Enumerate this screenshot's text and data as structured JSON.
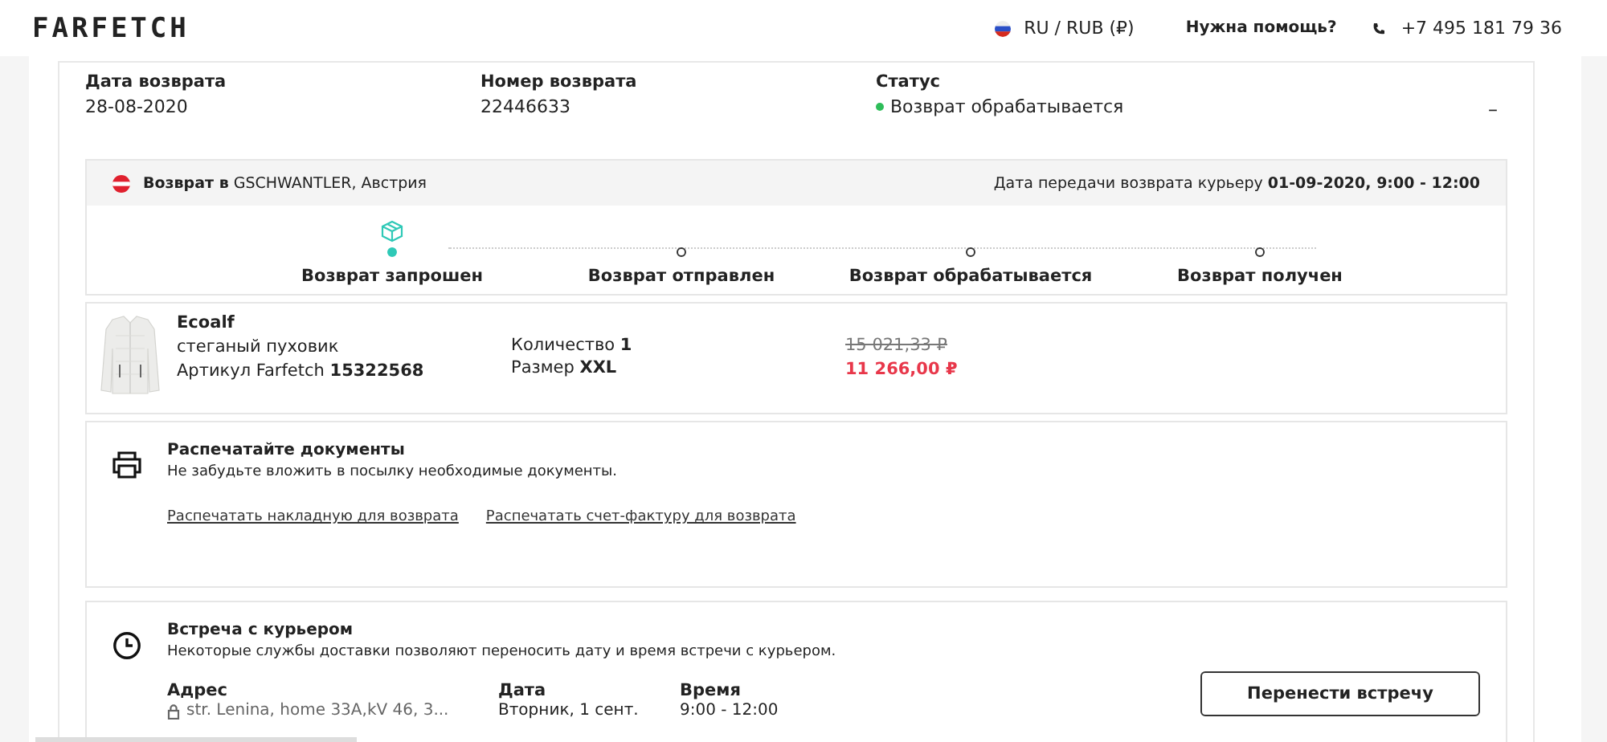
{
  "header": {
    "logo": "FARFETCH",
    "currency": "RU / RUB (₽)",
    "help": "Нужна помощь?",
    "phone": "+7 495 181 79 36"
  },
  "summary": {
    "fields": [
      {
        "label": "Дата возврата",
        "value": "28-08-2020"
      },
      {
        "label": "Номер возврата",
        "value": "22446633"
      },
      {
        "label": "Статус",
        "value": "Возврат обрабатывается",
        "color": "#2ebd59"
      }
    ],
    "collapse": "–"
  },
  "shipment": {
    "to": "**Возврат в** GSCHWANTLER, Австрия",
    "handover": "Дата передачи возврата курьеру **01-09-2020, 9:00 - 12:00**",
    "steps": [
      {
        "label": "Возврат запрошен",
        "selected": true
      },
      {
        "label": "Возврат отправлен",
        "selected": false
      },
      {
        "label": "Возврат обрабатывается",
        "selected": false
      },
      {
        "label": "Возврат получен",
        "selected": false
      }
    ]
  },
  "item": {
    "brand": "Ecoalf",
    "name": "стеганый пуховик",
    "article": "Артикул Farfetch **15322568**",
    "quantity": "Количество **1**",
    "size": "Размер **XXL**",
    "old_price": "15 021,33 ₽",
    "price": "11 266,00 ₽"
  },
  "print": {
    "title": "Распечатайте документы",
    "text": "Не забудьте вложить в посылку необходимые документы.",
    "links": [
      "Распечатать накладную для возврата",
      "Распечатать счет-фактуру для возврата"
    ]
  },
  "courier": {
    "title": "Встреча с курьером",
    "text": "Некоторые службы доставки позволяют переносить дату и время встречи с курьером.",
    "fields": [
      {
        "label": "Адрес",
        "value": "str. Lenina, home 33A,kV 46, 3...",
        "kind": "address"
      },
      {
        "label": "Дата",
        "value": "Вторник, 1 сент.",
        "kind": "plain"
      },
      {
        "label": "Время",
        "value": "9:00 - 12:00",
        "kind": "plain"
      }
    ],
    "button": "Перенести встречу"
  }
}
